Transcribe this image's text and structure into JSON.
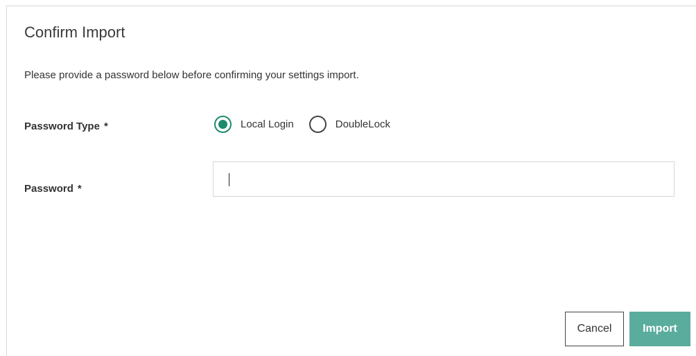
{
  "dialog": {
    "title": "Confirm Import",
    "message": "Please provide a password below before confirming your settings import."
  },
  "form": {
    "password_type": {
      "label": "Password Type",
      "required_marker": "*",
      "options": [
        {
          "label": "Local Login",
          "selected": true
        },
        {
          "label": "DoubleLock",
          "selected": false
        }
      ]
    },
    "password": {
      "label": "Password",
      "required_marker": "*",
      "value": "",
      "placeholder": ""
    }
  },
  "buttons": {
    "cancel_label": "Cancel",
    "import_label": "Import"
  },
  "colors": {
    "accent": "#1d8a6e",
    "import_button": "#5aac9c"
  }
}
